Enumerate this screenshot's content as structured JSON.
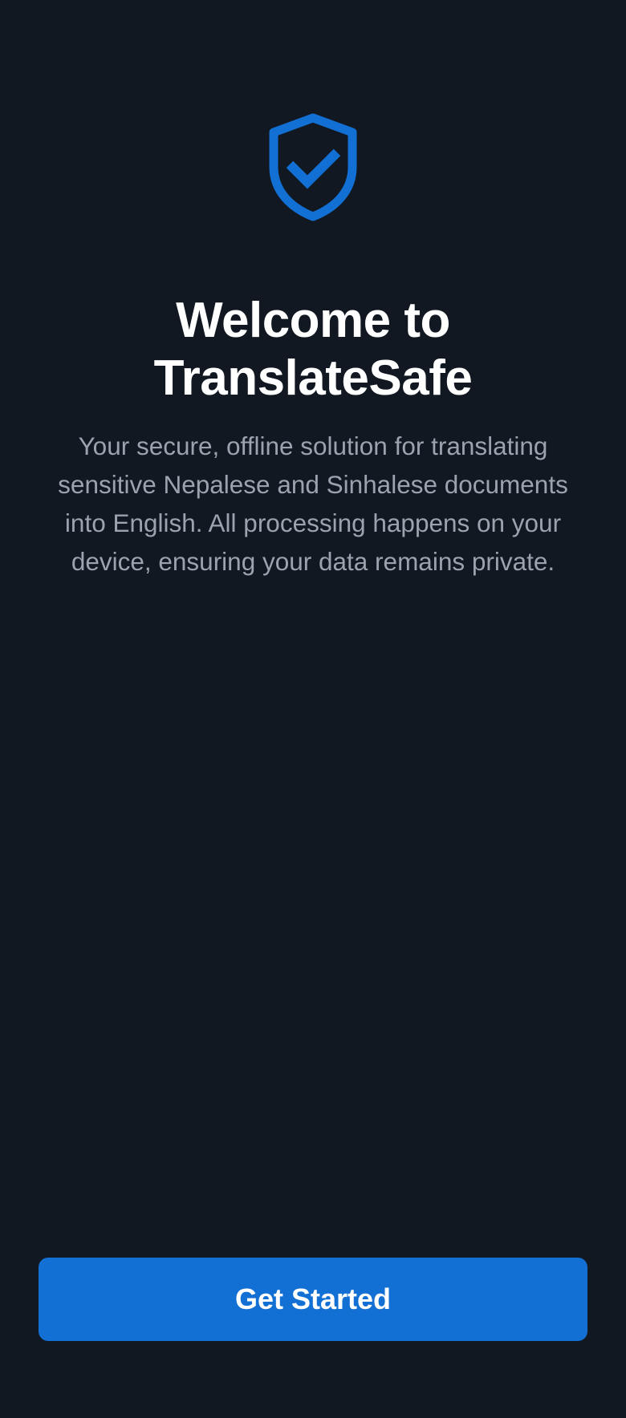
{
  "app": {
    "name": "TranslateSafe",
    "logo_icon": "shield-check-icon",
    "accent_color": "#1270d4",
    "background_color": "#111821"
  },
  "welcome": {
    "title_line1": "Welcome to",
    "title_line2": "TranslateSafe",
    "description": "Your secure, offline solution for translating sensitive Nepalese and Sinhalese documents into English. All processing happens on your device, ensuring your data remains private."
  },
  "actions": {
    "get_started_label": "Get Started"
  }
}
